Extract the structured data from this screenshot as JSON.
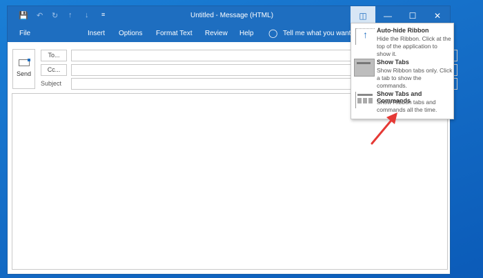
{
  "window": {
    "title": "Untitled  -  Message (HTML)"
  },
  "ribbon_tabs": [
    "File",
    "Insert",
    "Options",
    "Format Text",
    "Review",
    "Help"
  ],
  "tell_me": "Tell me what you want t",
  "compose": {
    "send": "Send",
    "to": "To...",
    "cc": "Cc...",
    "subject": "Subject",
    "to_value": "",
    "cc_value": "",
    "subject_value": ""
  },
  "ribbon_menu": [
    {
      "title": "Auto-hide Ribbon",
      "desc": "Hide the Ribbon. Click at the top of the application to show it."
    },
    {
      "title": "Show Tabs",
      "desc": "Show Ribbon tabs only. Click a tab to show the commands."
    },
    {
      "title": "Show Tabs and Commands",
      "desc": "Show Ribbon tabs and commands all the time."
    }
  ],
  "colors": {
    "titlebar": "#1e6ec0",
    "arrow": "#e53935"
  }
}
